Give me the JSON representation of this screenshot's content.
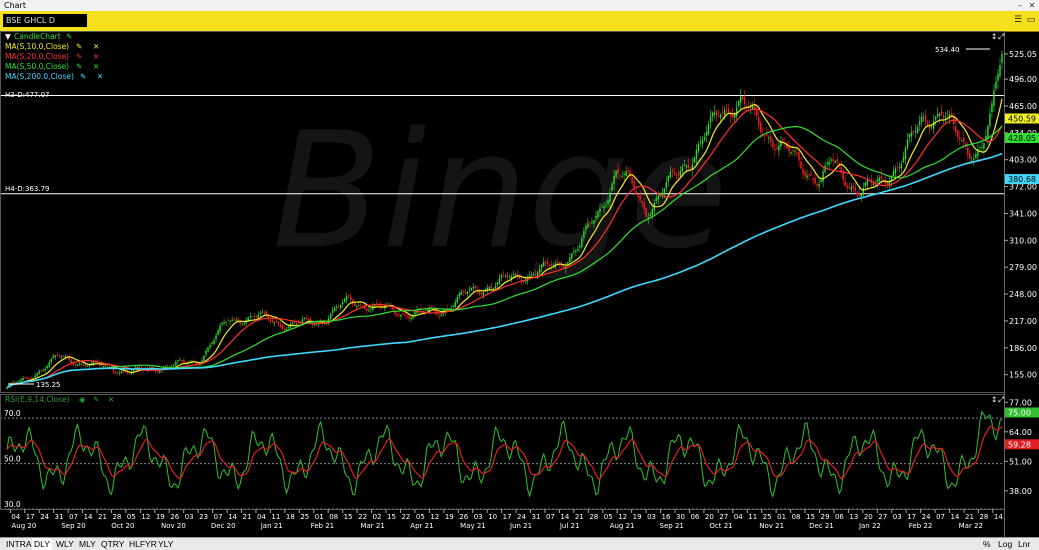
{
  "window": {
    "title": "Chart"
  },
  "toolbar": {
    "symbol": "BSE GHCL D"
  },
  "legend": {
    "candle_label": "CandleChart",
    "ma_items": [
      {
        "label": "MA(S,10.0,Close)",
        "color": "#f0f020"
      },
      {
        "label": "MA(S,20.0,Close)",
        "color": "#ff3030"
      },
      {
        "label": "MA(S,50.0,Close)",
        "color": "#30e030"
      },
      {
        "label": "MA(S,200.0,Close)",
        "color": "#40d8ff"
      }
    ],
    "rsi_label": "RSI(E,9,14,Close)"
  },
  "watermark": "Binge",
  "annotations": {
    "high_value": "534.40",
    "low_value": "135.25",
    "h3_label": "H3-D:477.07",
    "h4_label": "H4-D:363.79"
  },
  "bottom": {
    "periods": [
      "INTRA",
      "DLY",
      "WLY",
      "MLY",
      "QTRY",
      "HLFYR",
      "YLY"
    ],
    "active_period": "DLY",
    "scale_buttons": [
      "%",
      "Log",
      "Lnr"
    ]
  },
  "chart_data": [
    {
      "type": "candlestick",
      "title": "BSE GHCL D",
      "ylim": [
        135,
        540
      ],
      "y_ticks": [
        155.0,
        186.0,
        217.0,
        248.0,
        279.0,
        310.0,
        341.0,
        372.0,
        403.0,
        434.0,
        465.0,
        496.0,
        525.05
      ],
      "price_tags": [
        {
          "value": "525.05",
          "bg": "#ffffff",
          "fg": "#000000"
        },
        {
          "value": "450.59",
          "bg": "#f0f020",
          "fg": "#000000"
        },
        {
          "value": "428.05",
          "bg": "#30e030",
          "fg": "#000000"
        },
        {
          "value": "380.68",
          "bg": "#40d8ff",
          "fg": "#000000"
        }
      ],
      "horizontal_lines": [
        {
          "name": "H3-D",
          "value": 477.07
        },
        {
          "name": "H4-D",
          "value": 363.79
        }
      ],
      "last_close": 525.05,
      "period_high": 534.4,
      "period_low": 135.25,
      "close_keypoints": [
        [
          0,
          140
        ],
        [
          10,
          150
        ],
        [
          25,
          175
        ],
        [
          45,
          165
        ],
        [
          62,
          158
        ],
        [
          80,
          165
        ],
        [
          95,
          170
        ],
        [
          110,
          218
        ],
        [
          125,
          222
        ],
        [
          140,
          212
        ],
        [
          155,
          216
        ],
        [
          170,
          240
        ],
        [
          185,
          232
        ],
        [
          200,
          225
        ],
        [
          215,
          228
        ],
        [
          230,
          250
        ],
        [
          245,
          262
        ],
        [
          260,
          272
        ],
        [
          275,
          282
        ],
        [
          285,
          305
        ],
        [
          295,
          345
        ],
        [
          303,
          390
        ],
        [
          310,
          375
        ],
        [
          318,
          345
        ],
        [
          325,
          362
        ],
        [
          335,
          392
        ],
        [
          345,
          420
        ],
        [
          355,
          460
        ],
        [
          365,
          470
        ],
        [
          375,
          440
        ],
        [
          385,
          420
        ],
        [
          395,
          395
        ],
        [
          405,
          380
        ],
        [
          410,
          400
        ],
        [
          415,
          385
        ],
        [
          420,
          375
        ],
        [
          425,
          368
        ],
        [
          435,
          375
        ],
        [
          445,
          405
        ],
        [
          455,
          445
        ],
        [
          465,
          462
        ],
        [
          472,
          430
        ],
        [
          478,
          412
        ],
        [
          485,
          420
        ],
        [
          490,
          455
        ],
        [
          495,
          525
        ]
      ],
      "num_bars": 496
    },
    {
      "type": "line",
      "title": "RSI(E,9,14,Close)",
      "ylim": [
        30,
        78
      ],
      "y_ticks": [
        38.0,
        51.0,
        64.0,
        77.0
      ],
      "reference_levels": [
        70.0,
        50.0,
        30.0
      ],
      "price_tags": [
        {
          "value": "75.00",
          "bg": "#30c030",
          "fg": "#ffffff"
        },
        {
          "value": "59.28",
          "bg": "#e02020",
          "fg": "#ffffff"
        }
      ]
    }
  ],
  "x_axis": {
    "day_labels": [
      "04",
      "17",
      "24",
      "31",
      "07",
      "14",
      "21",
      "28",
      "05",
      "12",
      "19",
      "26",
      "03",
      "23",
      "07",
      "14",
      "21",
      "04",
      "11",
      "18",
      "25",
      "01",
      "08",
      "15",
      "22",
      "02",
      "15",
      "22",
      "05",
      "12",
      "19",
      "26",
      "03",
      "10",
      "17",
      "24",
      "31",
      "07",
      "14",
      "21",
      "28",
      "05",
      "12",
      "19",
      "03",
      "16",
      "30",
      "06",
      "20",
      "27",
      "04",
      "11",
      "25",
      "01",
      "08",
      "15",
      "29",
      "06",
      "13",
      "20",
      "27",
      "03",
      "17",
      "24",
      "07",
      "14",
      "21",
      "28",
      "14"
    ],
    "month_labels": [
      "Aug 20",
      "Sep 20",
      "Oct 20",
      "Nov 20",
      "Dec 20",
      "Jan 21",
      "Feb 21",
      "Mar 21",
      "Apr 21",
      "May 21",
      "Jun 21",
      "Jul 21",
      "Aug 21",
      "Sep 21",
      "Oct 21",
      "Nov 21",
      "Dec 21",
      "Jan 22",
      "Feb 22",
      "Mar 22"
    ]
  }
}
